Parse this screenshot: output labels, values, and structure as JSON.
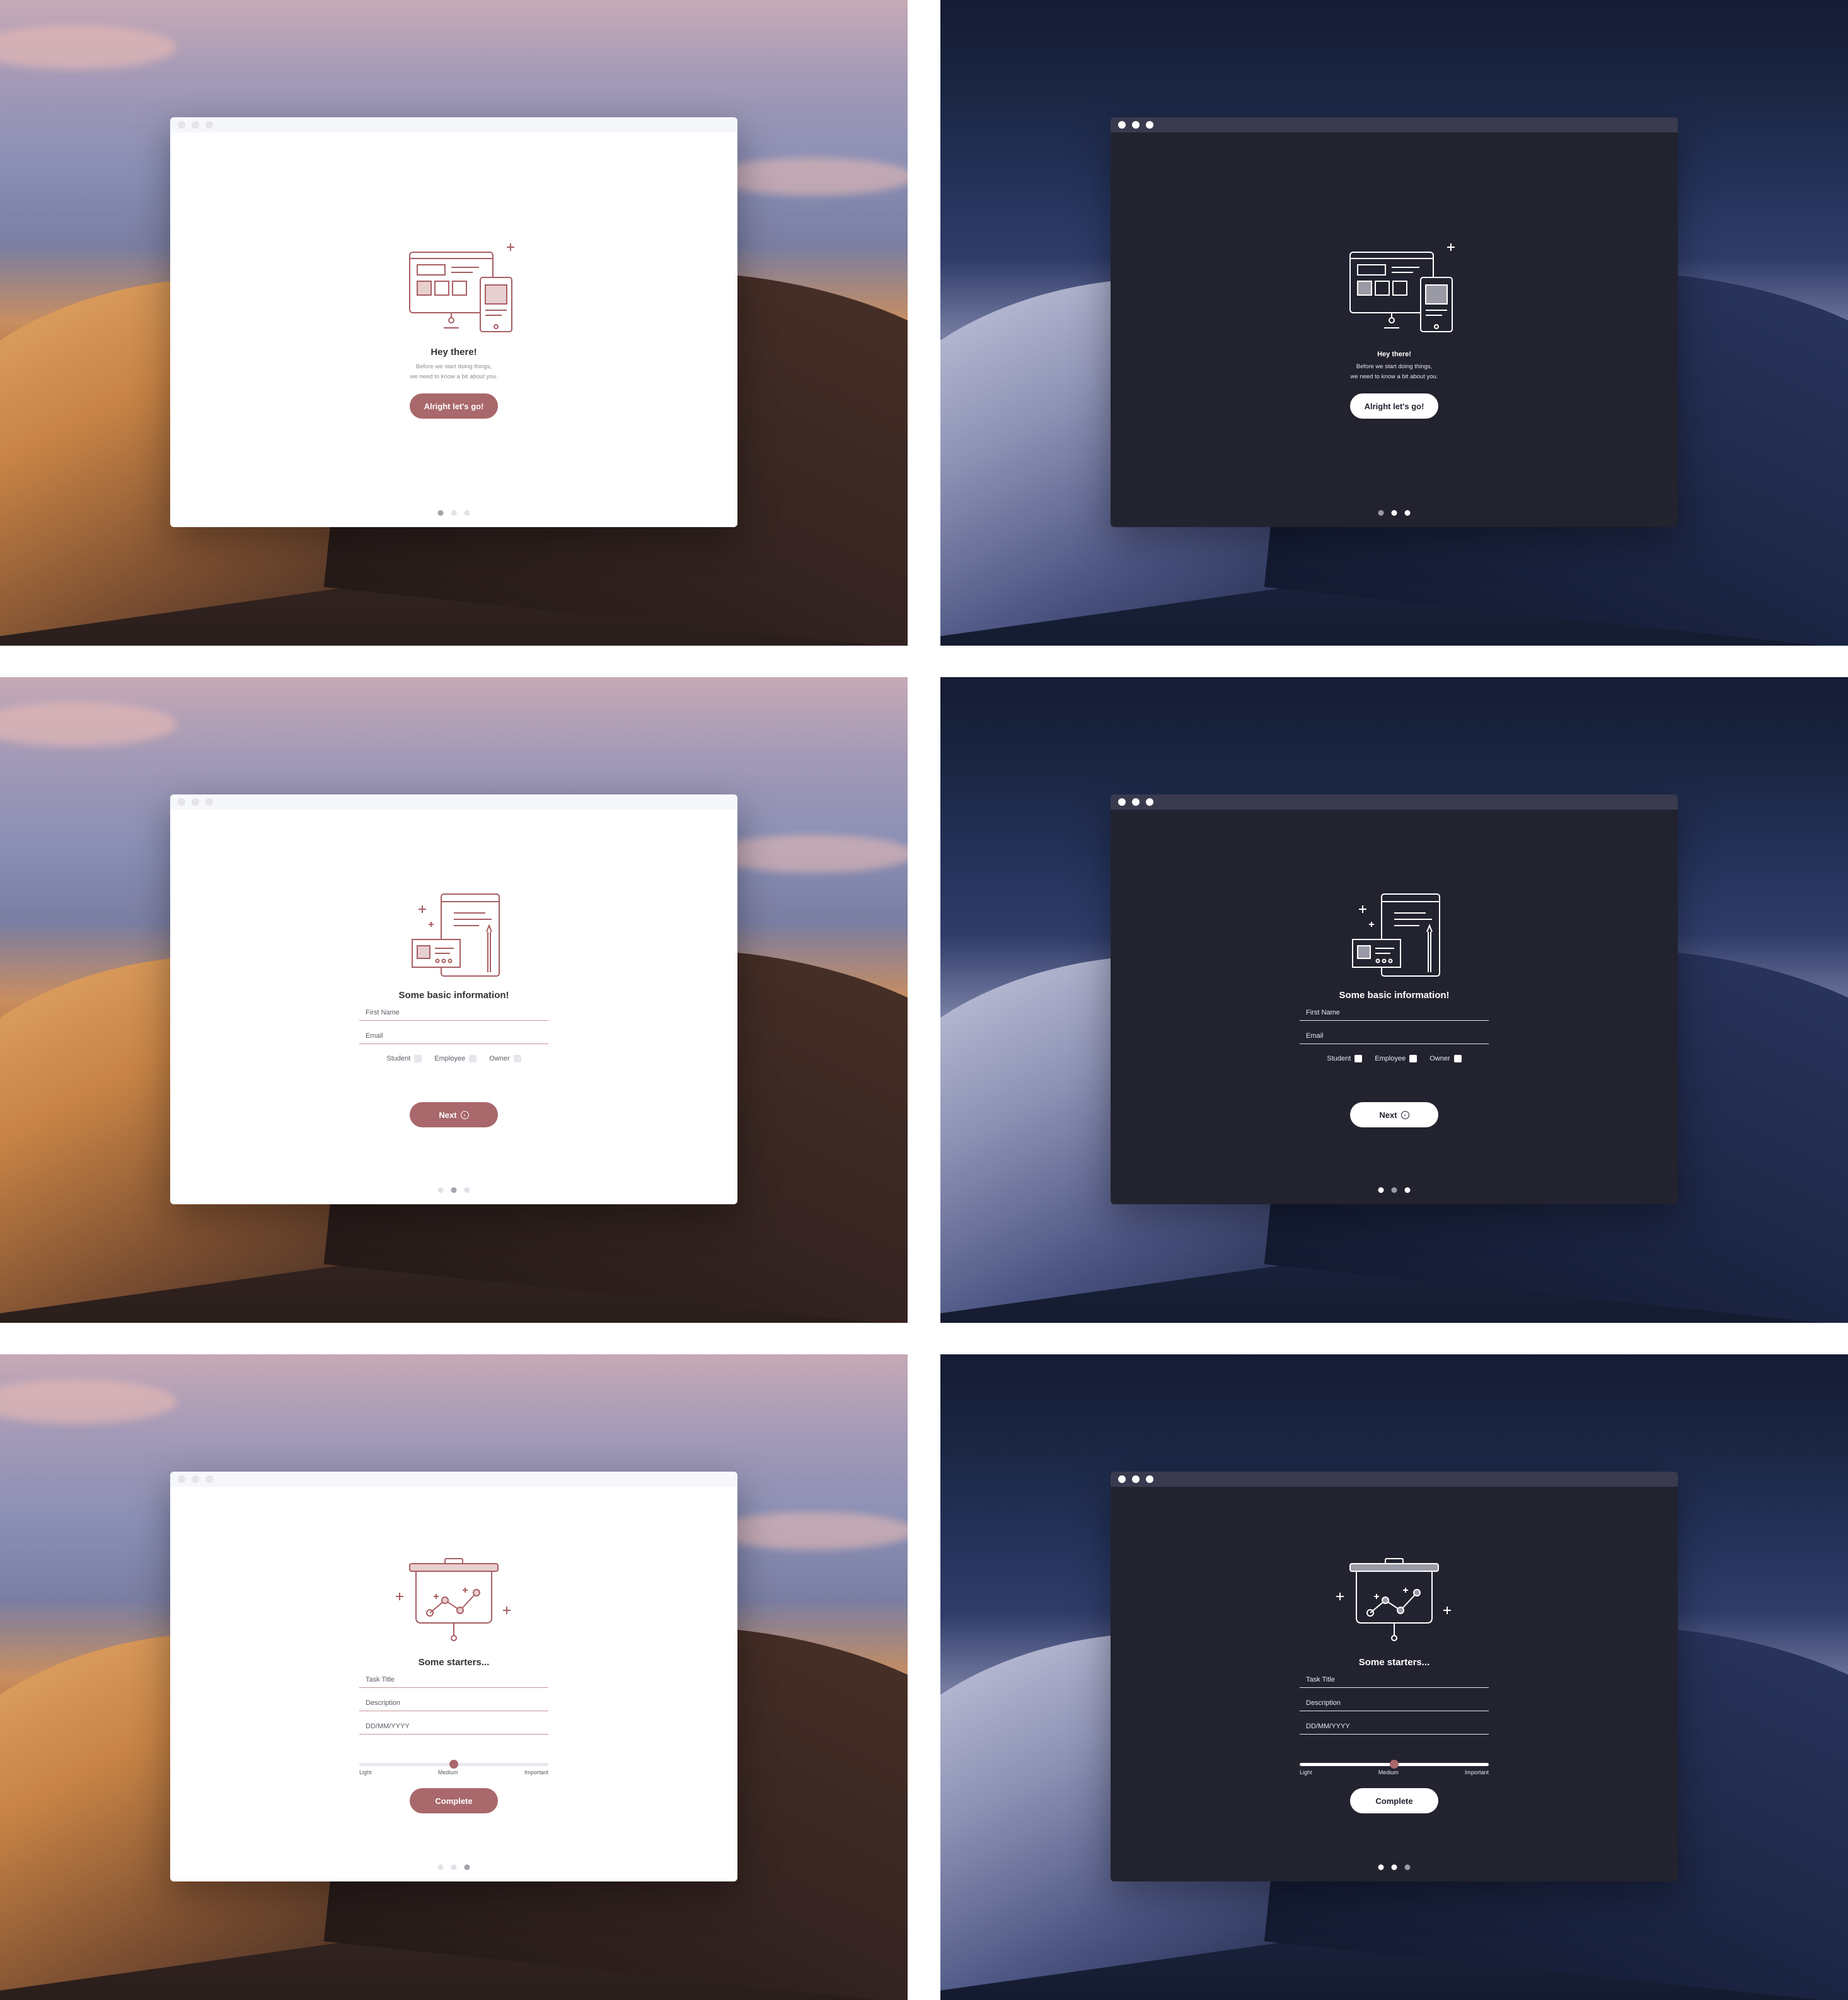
{
  "colors": {
    "accent": "#a9686b",
    "dark_window": "#22232f",
    "dark_titlebar": "#3a3a4f",
    "light_window": "#ffffff"
  },
  "welcome": {
    "title": "Hey there!",
    "subtitle_line1": "Before we start doing things,",
    "subtitle_line2": "we need to know a bit about you.",
    "button": "Alright let's go!"
  },
  "info": {
    "title": "Some basic information!",
    "first_name_placeholder": "First Name",
    "email_placeholder": "Email",
    "roles": [
      "Student",
      "Employee",
      "Owner"
    ],
    "button": "Next"
  },
  "starters": {
    "title": "Some starters...",
    "task_title_placeholder": "Task Title",
    "description_placeholder": "Description",
    "date_placeholder": "DD/MM/YYYY",
    "priority_labels": [
      "Light",
      "Medium",
      "Important"
    ],
    "priority_value": "Medium",
    "button": "Complete"
  },
  "pagination": {
    "total": 3
  }
}
